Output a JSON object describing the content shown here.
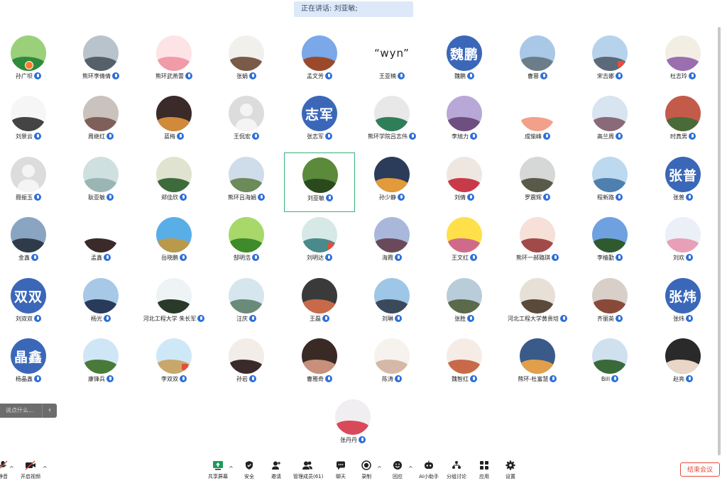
{
  "banner": {
    "label": "正在讲话: 刘亚敏;"
  },
  "participants": [
    {
      "name": "孙广坝",
      "style": "photo",
      "colors": [
        "#9ad07a",
        "#2f8a3b"
      ],
      "badge": "crown"
    },
    {
      "name": "熊环李倩倩",
      "style": "photo",
      "colors": [
        "#b8c3cc",
        "#55606a"
      ]
    },
    {
      "name": "熊环武燕蕾",
      "style": "photo",
      "colors": [
        "#fde3e6",
        "#f19aa8"
      ]
    },
    {
      "name": "张娟",
      "style": "photo",
      "colors": [
        "#f2f0ec",
        "#7a5a48"
      ]
    },
    {
      "name": "孟文芳",
      "style": "photo",
      "colors": [
        "#7aa8e8",
        "#9a4a2a"
      ]
    },
    {
      "name": "王亚楠",
      "style": "quote",
      "text": "“wyn”"
    },
    {
      "name": "魏鹏",
      "style": "text",
      "text": "魏鹏"
    },
    {
      "name": "曹蓉",
      "style": "photo",
      "colors": [
        "#a9c7e6",
        "#6c7d8a"
      ]
    },
    {
      "name": "宋吉娜",
      "style": "photo",
      "colors": [
        "#b7d3ec",
        "#5b6978"
      ],
      "badge": "red"
    },
    {
      "name": "杜志玲",
      "style": "photo",
      "colors": [
        "#f2eee4",
        "#9b6eb0"
      ]
    },
    {
      "name": "刘景云",
      "style": "photo",
      "colors": [
        "#f6f6f6",
        "#444444"
      ]
    },
    {
      "name": "周继红",
      "style": "photo",
      "colors": [
        "#c9c2bd",
        "#7f5f5a"
      ]
    },
    {
      "name": "蓝梅",
      "style": "photo",
      "colors": [
        "#3a2a2a",
        "#d08a3a"
      ]
    },
    {
      "name": "王侃宏",
      "style": "blank"
    },
    {
      "name": "张志军",
      "style": "text",
      "text": "志军"
    },
    {
      "name": "熊环学院吕志伟",
      "style": "photo",
      "colors": [
        "#e8e8e8",
        "#2f7e5a"
      ]
    },
    {
      "name": "李旭力",
      "style": "photo",
      "colors": [
        "#b8a8d8",
        "#6f4f7f"
      ]
    },
    {
      "name": "成愉峰",
      "style": "photo",
      "colors": [
        "#ffffff",
        "#f2a08a"
      ]
    },
    {
      "name": "高兰周",
      "style": "photo",
      "colors": [
        "#d8e4ef",
        "#8a6a78"
      ]
    },
    {
      "name": "时真男",
      "style": "photo",
      "colors": [
        "#c45a4a",
        "#4a6a3a"
      ]
    },
    {
      "name": "聂振玉",
      "style": "blank"
    },
    {
      "name": "耿亚敏",
      "style": "photo",
      "colors": [
        "#cfe0e0",
        "#9bb5b5"
      ]
    },
    {
      "name": "郑佳欣",
      "style": "photo",
      "colors": [
        "#dfe3cf",
        "#3d6b3b"
      ]
    },
    {
      "name": "熊环吕海娟",
      "style": "photo",
      "colors": [
        "#cfdcea",
        "#6c8a5a"
      ]
    },
    {
      "name": "刘亚敏",
      "style": "photo",
      "colors": [
        "#5a8a3a",
        "#2a4a1e"
      ],
      "active": true
    },
    {
      "name": "孙少静",
      "style": "photo",
      "colors": [
        "#2b3b5a",
        "#e29a3a"
      ]
    },
    {
      "name": "刘倩",
      "style": "photo",
      "colors": [
        "#f0e6e0",
        "#c83a4a"
      ]
    },
    {
      "name": "罗震辉",
      "style": "photo",
      "colors": [
        "#d5d8d6",
        "#5a5a4a"
      ]
    },
    {
      "name": "程新路",
      "style": "photo",
      "colors": [
        "#bcd9ef",
        "#4f7fae"
      ]
    },
    {
      "name": "张普",
      "style": "text",
      "text": "张普"
    },
    {
      "name": "金鑫",
      "style": "photo",
      "colors": [
        "#8aa5c2",
        "#2f3b4a"
      ]
    },
    {
      "name": "孟鑫",
      "style": "photo",
      "colors": [
        "#ffffff",
        "#3a2a2a"
      ]
    },
    {
      "name": "岳晓鹏",
      "style": "photo",
      "colors": [
        "#5aaee8",
        "#b89a4a"
      ]
    },
    {
      "name": "郜明浩",
      "style": "photo",
      "colors": [
        "#a8d86a",
        "#3f8a2a"
      ]
    },
    {
      "name": "刘明达",
      "style": "photo",
      "colors": [
        "#d6e9e6",
        "#4a8a8a"
      ],
      "badge": "red"
    },
    {
      "name": "海霞",
      "style": "photo",
      "colors": [
        "#a9b8da",
        "#6a4a5a"
      ]
    },
    {
      "name": "王文红",
      "style": "photo",
      "colors": [
        "#ffe04a",
        "#d06a8a"
      ]
    },
    {
      "name": "熊环一郝璐琪",
      "style": "photo",
      "colors": [
        "#f6e0d8",
        "#a24a4a"
      ]
    },
    {
      "name": "李樯勤",
      "style": "photo",
      "colors": [
        "#6fa0e0",
        "#2f5a2f"
      ]
    },
    {
      "name": "刘欢",
      "style": "photo",
      "colors": [
        "#eaf0f6",
        "#e8a0b8"
      ]
    },
    {
      "name": "刘双双",
      "style": "text",
      "text": "双双"
    },
    {
      "name": "杨光",
      "style": "photo",
      "colors": [
        "#a7c8e6",
        "#2a3a5a"
      ]
    },
    {
      "name": "河北工程大学 朱长军",
      "style": "photo",
      "colors": [
        "#eef3f6",
        "#2a3a2a"
      ]
    },
    {
      "name": "汪庆",
      "style": "photo",
      "colors": [
        "#d6e6ee",
        "#6a8a7a"
      ]
    },
    {
      "name": "王磊",
      "style": "photo",
      "colors": [
        "#3a3a3a",
        "#c86a4a"
      ]
    },
    {
      "name": "刘琳",
      "style": "photo",
      "colors": [
        "#9ec6e6",
        "#3a4a5a"
      ]
    },
    {
      "name": "张胜",
      "style": "photo",
      "colors": [
        "#b9ccd9",
        "#5a6a4a"
      ]
    },
    {
      "name": "河北工程大学黄贵培",
      "style": "photo",
      "colors": [
        "#e6e0d6",
        "#5a4a3a"
      ]
    },
    {
      "name": "齐丽英",
      "style": "photo",
      "colors": [
        "#d8d0c8",
        "#8a4a3a"
      ]
    },
    {
      "name": "张炜",
      "style": "text",
      "text": "张炜"
    },
    {
      "name": "杨晶鑫",
      "style": "text",
      "text": "晶鑫"
    },
    {
      "name": "康锋兵",
      "style": "photo",
      "colors": [
        "#cfe6f6",
        "#4a7a3a"
      ]
    },
    {
      "name": "李双双",
      "style": "photo",
      "colors": [
        "#cfe8f8",
        "#c8a86a"
      ],
      "badge": "red"
    },
    {
      "name": "孙岩",
      "style": "photo",
      "colors": [
        "#f2ede8",
        "#3a2a2a"
      ]
    },
    {
      "name": "曹雅奇",
      "style": "photo",
      "colors": [
        "#3a2a26",
        "#c8907a"
      ]
    },
    {
      "name": "陈涛",
      "style": "photo",
      "colors": [
        "#f6f2ee",
        "#d6b8a8"
      ]
    },
    {
      "name": "魏智红",
      "style": "photo",
      "colors": [
        "#f6ece6",
        "#c86a4a"
      ]
    },
    {
      "name": "熊环-杜富慧",
      "style": "photo",
      "colors": [
        "#3a5a8a",
        "#e0a04a"
      ]
    },
    {
      "name": "Bill",
      "style": "photo",
      "colors": [
        "#cfe0ee",
        "#3a6a3a"
      ]
    },
    {
      "name": "赵亮",
      "style": "photo",
      "colors": [
        "#2a2a2a",
        "#e8d6c8"
      ]
    },
    {
      "name": "张丹丹",
      "style": "photo",
      "colors": [
        "#f0eef0",
        "#d84a5a"
      ]
    }
  ],
  "chat": {
    "placeholder": "说点什么...",
    "collapse_icon": "‹"
  },
  "toolbar": {
    "mute": "静音",
    "video": "开启视频",
    "share": "共享屏幕",
    "security": "安全",
    "invite": "邀请",
    "manage": "管理成员(61)",
    "chat": "聊天",
    "record": "录制",
    "react": "回应",
    "ai": "AI小助手",
    "breakout": "分组讨论",
    "apps": "应用",
    "settings": "设置",
    "end": "结束会议"
  },
  "colors": {
    "accent": "#3b67b9",
    "mic": "#2e6fd8",
    "active_border": "#34b27b",
    "end": "#e24a3b"
  }
}
